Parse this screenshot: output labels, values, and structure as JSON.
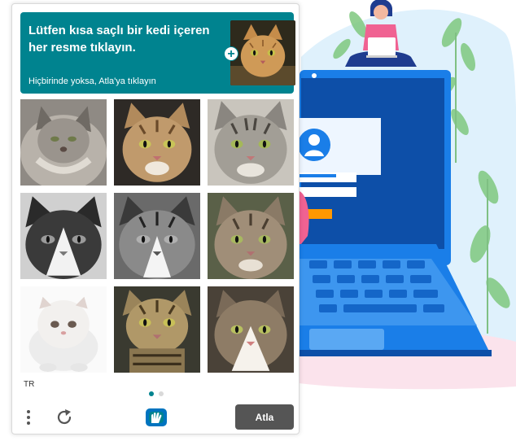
{
  "captcha": {
    "prompt": {
      "title": "Lütfen kısa saçlı bir kedi içeren her resme tıklayın.",
      "subtitle": "Hiçbirinde yoksa, Atla'ya tıklayın",
      "example_icon": "plus-icon"
    },
    "tiles": [
      {
        "desc": "fluffy long-haired grey cat"
      },
      {
        "desc": "short-haired tabby cat"
      },
      {
        "desc": "short-haired silver tabby cat"
      },
      {
        "desc": "black and white short-haired cat (greyscale)"
      },
      {
        "desc": "black and white tabby cat (greyscale)"
      },
      {
        "desc": "short-haired tabby cat"
      },
      {
        "desc": "white persian kitten"
      },
      {
        "desc": "short-haired tabby cat"
      },
      {
        "desc": "tabby and white cat"
      }
    ],
    "language": "TR",
    "page_indicator": {
      "current": 1,
      "total": 2
    },
    "skip_label": "Atla",
    "icons": {
      "menu": "kebab-menu-icon",
      "refresh": "refresh-icon",
      "logo": "hcaptcha-logo-icon"
    }
  },
  "colors": {
    "accent": "#00838f",
    "skip_button": "#555555",
    "laptop": "#1a7ee8",
    "laptop_screen": "#0d4fa8",
    "leaves": "#7fc87f"
  }
}
